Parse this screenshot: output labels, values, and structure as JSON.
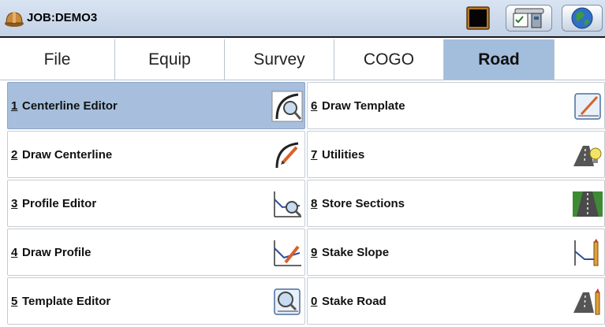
{
  "titlebar": {
    "job_title": "JOB:DEMO3",
    "icons": [
      "hardhat-icon",
      "data-screen-icon",
      "instrument-icon",
      "globe-icon"
    ]
  },
  "tabs": [
    {
      "label": "File",
      "active": false
    },
    {
      "label": "Equip",
      "active": false
    },
    {
      "label": "Survey",
      "active": false
    },
    {
      "label": "COGO",
      "active": false
    },
    {
      "label": "Road",
      "active": true
    }
  ],
  "menu": {
    "left": [
      {
        "num": "1",
        "label": "Centerline Editor",
        "icon": "centerline-editor-icon",
        "selected": true
      },
      {
        "num": "2",
        "label": "Draw Centerline",
        "icon": "draw-centerline-icon",
        "selected": false
      },
      {
        "num": "3",
        "label": "Profile Editor",
        "icon": "profile-editor-icon",
        "selected": false
      },
      {
        "num": "4",
        "label": "Draw Profile",
        "icon": "draw-profile-icon",
        "selected": false
      },
      {
        "num": "5",
        "label": "Template Editor",
        "icon": "template-editor-icon",
        "selected": false
      }
    ],
    "right": [
      {
        "num": "6",
        "label": "Draw Template",
        "icon": "draw-template-icon",
        "selected": false
      },
      {
        "num": "7",
        "label": "Utilities",
        "icon": "road-utilities-icon",
        "selected": false
      },
      {
        "num": "8",
        "label": "Store Sections",
        "icon": "store-sections-icon",
        "selected": false
      },
      {
        "num": "9",
        "label": "Stake Slope",
        "icon": "stake-slope-icon",
        "selected": false
      },
      {
        "num": "0",
        "label": "Stake Road",
        "icon": "stake-road-icon",
        "selected": false
      }
    ]
  },
  "colors": {
    "titlebar": "#c9d7ea",
    "active_tab": "#a3bddc",
    "selected_item": "#a7bfdd",
    "border": "#c7ccd3"
  }
}
